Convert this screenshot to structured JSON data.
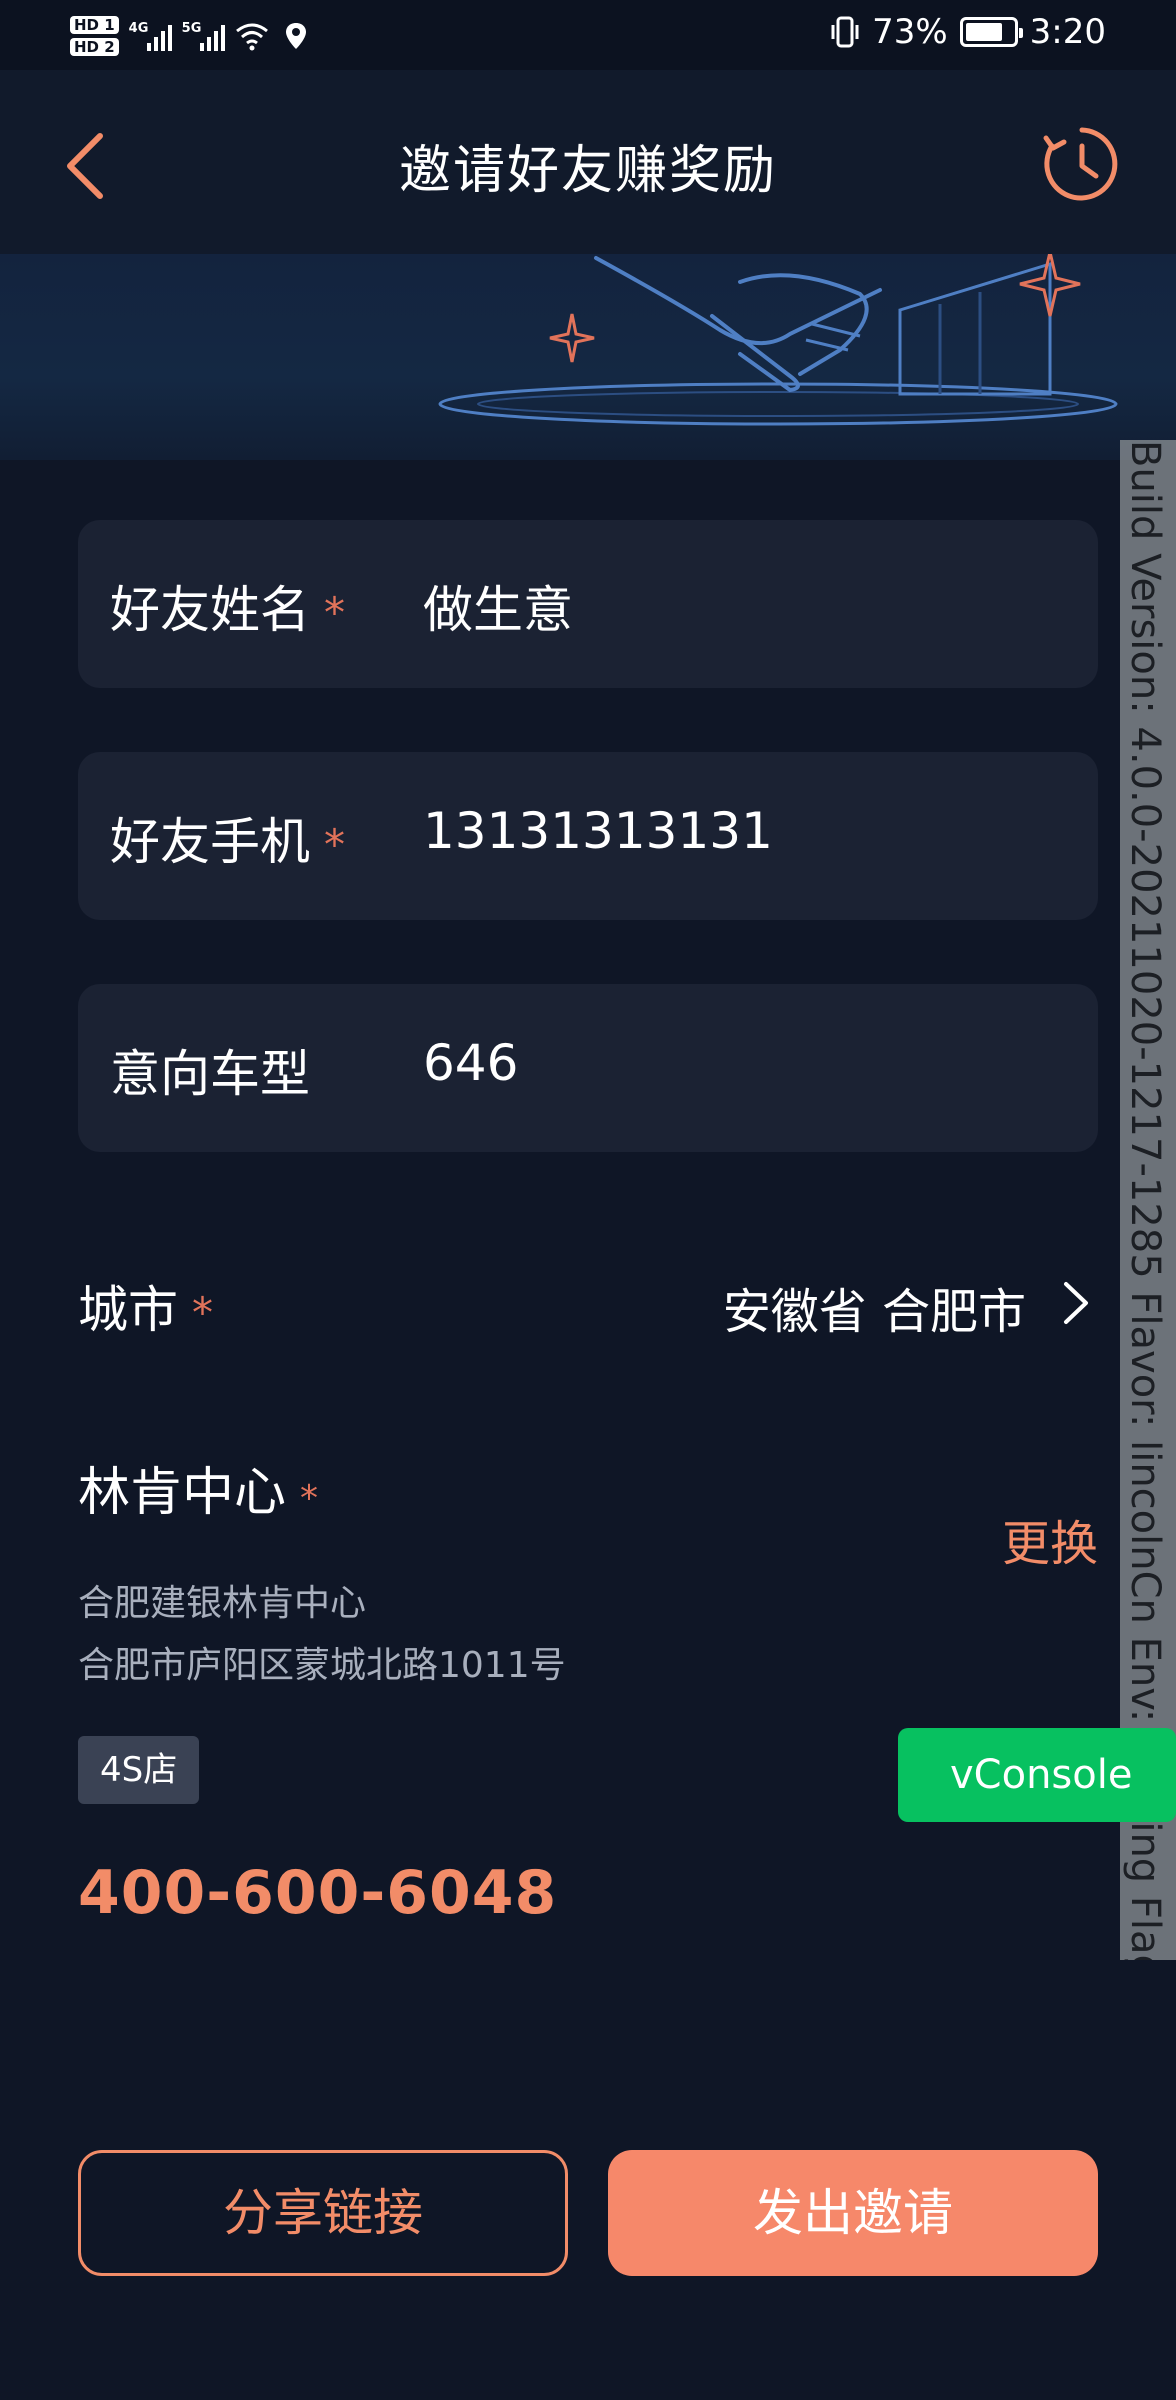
{
  "status_bar": {
    "hd1": "HD 1",
    "hd2": "HD 2",
    "net1": "4G",
    "net2": "5G",
    "battery": "73%",
    "time": "3:20"
  },
  "nav": {
    "title": "邀请好友赚奖励"
  },
  "form": {
    "required_mark": "*",
    "fields": [
      {
        "label": "好友姓名",
        "required": true,
        "value": "做生意"
      },
      {
        "label": "好友手机",
        "required": true,
        "value": "13131313131"
      },
      {
        "label": "意向车型",
        "required": false,
        "value": "646"
      }
    ],
    "city": {
      "label": "城市",
      "value": "安徽省 合肥市"
    }
  },
  "dealer": {
    "title": "林肯中心",
    "change_label": "更换",
    "name": "合肥建银林肯中心",
    "address": "合肥市庐阳区蒙城北路1011号",
    "tag": "4S店",
    "phone": "400-600-6048"
  },
  "debug": {
    "vconsole_label": "vConsole",
    "build_info": "Build Version: 4.0.0-20211020-1217-1285 Flavor: lincolnCn Env: staging Flags:"
  },
  "actions": {
    "share_label": "分享链接",
    "invite_label": "发出邀请"
  },
  "colors": {
    "accent": "#f28c68",
    "background": "#0f1626",
    "field_bg": "#1b2233",
    "vconsole": "#07c160"
  }
}
